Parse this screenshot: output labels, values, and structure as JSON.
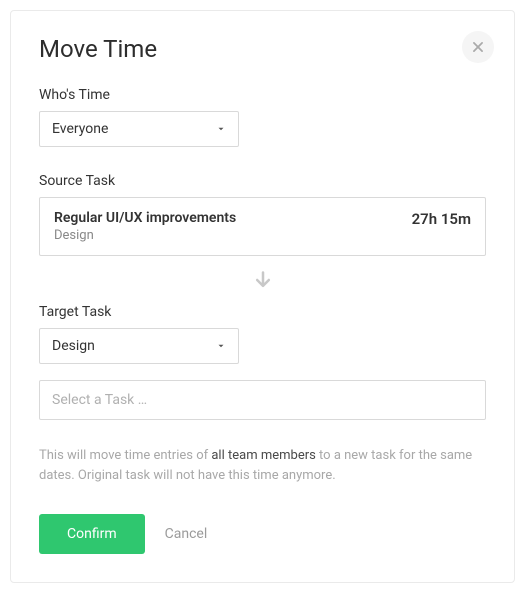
{
  "dialog": {
    "title": "Move Time"
  },
  "whos_time": {
    "label": "Who's Time",
    "value": "Everyone"
  },
  "source_task": {
    "label": "Source Task",
    "task_name": "Regular UI/UX improvements",
    "task_project": "Design",
    "duration": "27h 15m"
  },
  "target_task": {
    "label": "Target Task",
    "project_value": "Design",
    "task_placeholder": "Select a Task …"
  },
  "note": {
    "pre": "This will move time entries of ",
    "strong": "all team members",
    "post": " to a new task for the same dates. Original task will not have this time anymore."
  },
  "actions": {
    "confirm": "Confirm",
    "cancel": "Cancel"
  }
}
